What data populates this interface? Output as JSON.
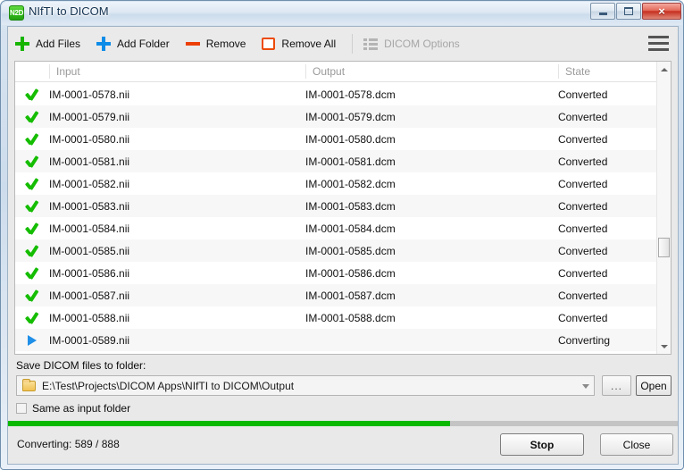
{
  "window": {
    "title": "NIfTI to DICOM",
    "app_icon": "N2D",
    "minimize_label": "Minimize",
    "maximize_label": "Maximize",
    "close_label": "×"
  },
  "toolbar": {
    "add_files": {
      "label": "Add Files",
      "icon": "plus-green-icon"
    },
    "add_folder": {
      "label": "Add Folder",
      "icon": "plus-blue-icon"
    },
    "remove": {
      "label": "Remove",
      "icon": "minus-orange-icon"
    },
    "remove_all": {
      "label": "Remove All",
      "icon": "square-orange-icon"
    },
    "dicom_options": {
      "label": "DICOM Options",
      "icon": "list-icon",
      "enabled": false
    },
    "menu": {
      "label": "Menu",
      "icon": "hamburger-icon"
    }
  },
  "table": {
    "columns": [
      "Input",
      "Output",
      "State"
    ],
    "rows": [
      {
        "icon": "check",
        "input": "IM-0001-0578.nii",
        "output": "IM-0001-0578.dcm",
        "state": "Converted"
      },
      {
        "icon": "check",
        "input": "IM-0001-0579.nii",
        "output": "IM-0001-0579.dcm",
        "state": "Converted"
      },
      {
        "icon": "check",
        "input": "IM-0001-0580.nii",
        "output": "IM-0001-0580.dcm",
        "state": "Converted"
      },
      {
        "icon": "check",
        "input": "IM-0001-0581.nii",
        "output": "IM-0001-0581.dcm",
        "state": "Converted"
      },
      {
        "icon": "check",
        "input": "IM-0001-0582.nii",
        "output": "IM-0001-0582.dcm",
        "state": "Converted"
      },
      {
        "icon": "check",
        "input": "IM-0001-0583.nii",
        "output": "IM-0001-0583.dcm",
        "state": "Converted"
      },
      {
        "icon": "check",
        "input": "IM-0001-0584.nii",
        "output": "IM-0001-0584.dcm",
        "state": "Converted"
      },
      {
        "icon": "check",
        "input": "IM-0001-0585.nii",
        "output": "IM-0001-0585.dcm",
        "state": "Converted"
      },
      {
        "icon": "check",
        "input": "IM-0001-0586.nii",
        "output": "IM-0001-0586.dcm",
        "state": "Converted"
      },
      {
        "icon": "check",
        "input": "IM-0001-0587.nii",
        "output": "IM-0001-0587.dcm",
        "state": "Converted"
      },
      {
        "icon": "check",
        "input": "IM-0001-0588.nii",
        "output": "IM-0001-0588.dcm",
        "state": "Converted"
      },
      {
        "icon": "play",
        "input": "IM-0001-0589.nii",
        "output": "",
        "state": "Converting"
      }
    ]
  },
  "output_folder": {
    "label": "Save DICOM files to folder:",
    "path": "E:\\Test\\Projects\\DICOM Apps\\NIfTI to DICOM\\Output",
    "browse_label": "...",
    "open_label": "Open",
    "same_as_input_label": "Same as input folder",
    "same_as_input_checked": false,
    "folder_icon": "folder-icon"
  },
  "progress": {
    "percent": 66,
    "bar_color": "#0bb800"
  },
  "status": {
    "text": "Converting: 589 / 888",
    "current": 589,
    "total": 888
  },
  "buttons": {
    "stop": "Stop",
    "close": "Close"
  },
  "colors": {
    "accent_green": "#15bd00",
    "accent_blue": "#0d8ce8",
    "accent_orange": "#ec4b0a",
    "progress_green": "#0bb800"
  }
}
